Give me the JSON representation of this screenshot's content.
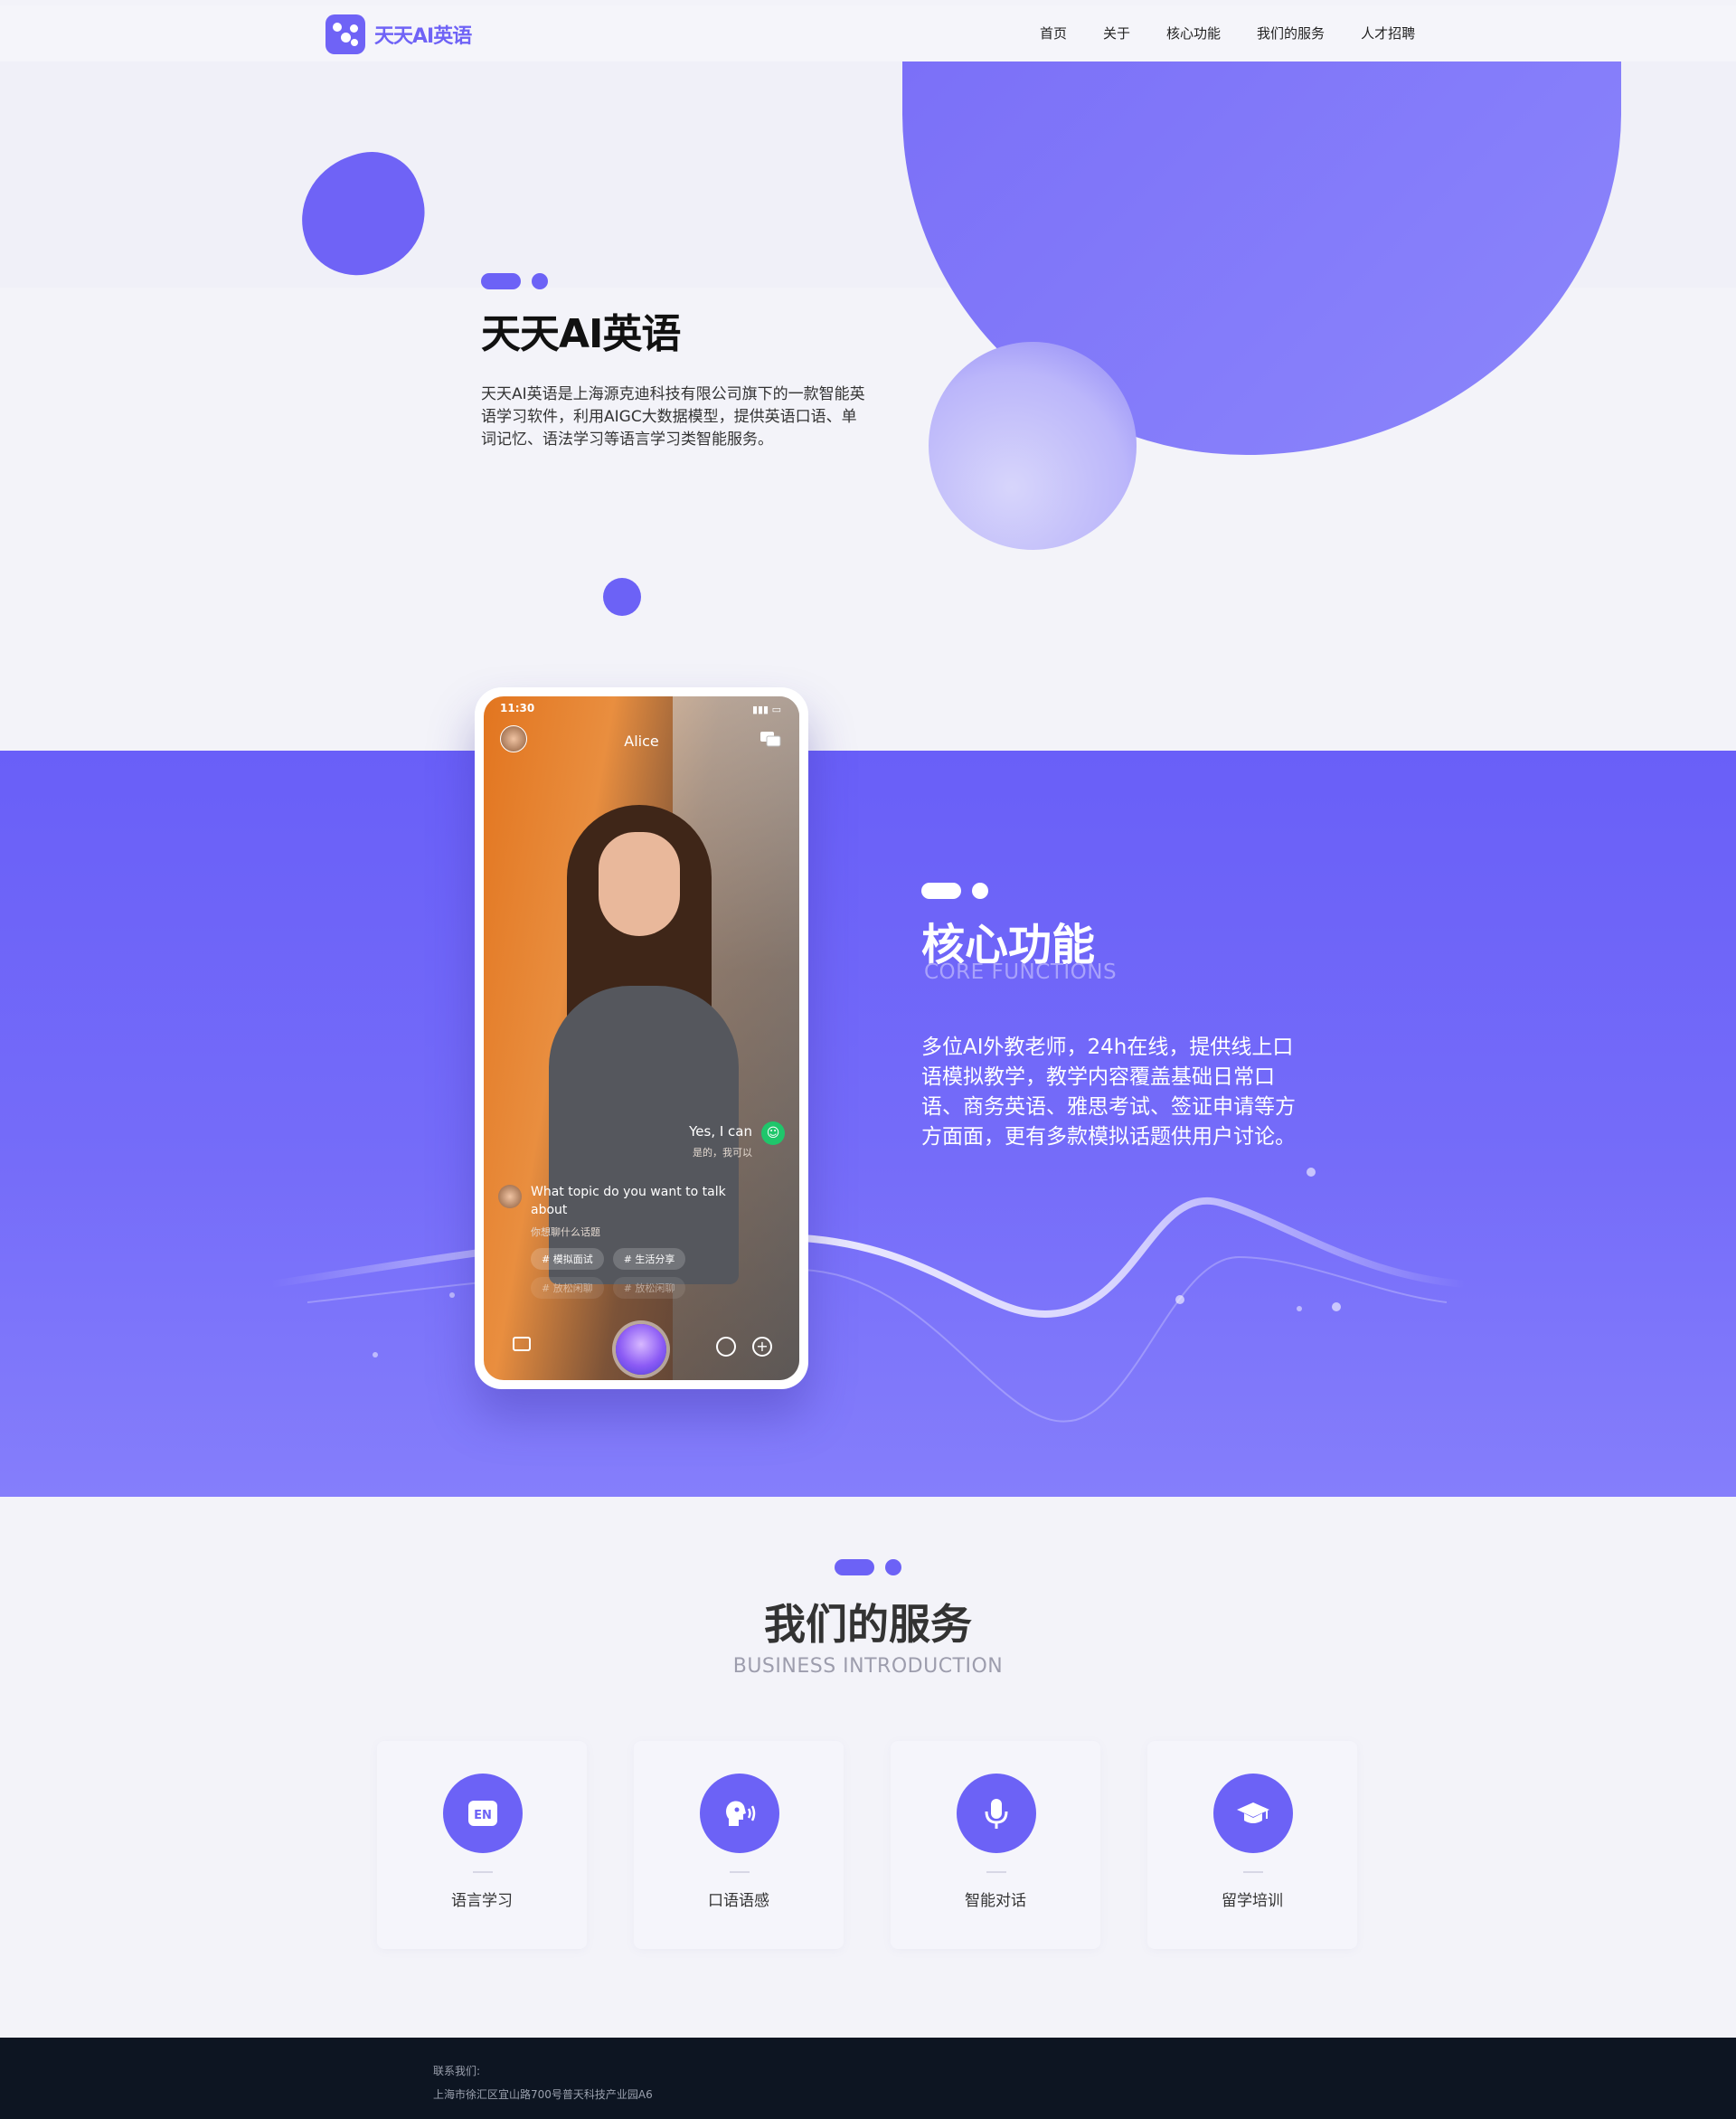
{
  "brand": {
    "logo_text": "天天AI英语",
    "accent": "#6c62f6"
  },
  "nav": {
    "items": [
      "首页",
      "关于",
      "核心功能",
      "我们的服务",
      "人才招聘"
    ]
  },
  "hero": {
    "title": "天天AI英语",
    "description": "天天AI英语是上海源克迪科技有限公司旗下的一款智能英语学习软件，利用AIGC大数据模型，提供英语口语、单词记忆、语法学习等语言学习类智能服务。"
  },
  "features": {
    "title": "核心功能",
    "subtitle": "CORE FUNCTIONS",
    "description": "多位AI外教老师，24h在线，提供线上口语模拟教学，教学内容覆盖基础日常口语、商务英语、雅思考试、签证申请等方方面面，更有多款模拟话题供用户讨论。",
    "phone": {
      "time": "11:30",
      "contact_name": "Alice",
      "reply_en": "Yes, I can",
      "reply_cn": "是的，我可以",
      "question_en": "What topic do you want to talk about",
      "question_cn": "你想聊什么话题",
      "tags": [
        "# 模拟面试",
        "# 生活分享",
        "# 放松闲聊",
        "# 放松闲聊"
      ]
    }
  },
  "services": {
    "title": "我们的服务",
    "subtitle": "BUSINESS INTRODUCTION",
    "cards": [
      {
        "label": "语言学习",
        "icon": "en-icon"
      },
      {
        "label": "口语语感",
        "icon": "speaking-head-icon"
      },
      {
        "label": "智能对话",
        "icon": "microphone-icon"
      },
      {
        "label": "留学培训",
        "icon": "graduation-cap-icon"
      }
    ]
  },
  "footer": {
    "contact_label": "联系我们:",
    "address": "上海市徐汇区宜山路700号普天科技产业园A6"
  }
}
